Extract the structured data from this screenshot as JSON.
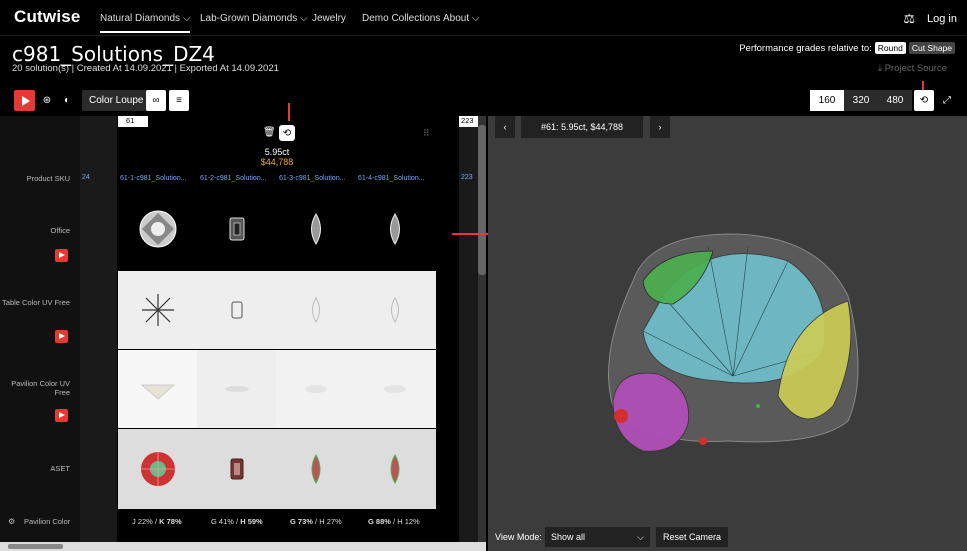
{
  "nav": {
    "logo": "Cutwise",
    "items": [
      "Natural Diamonds",
      "Lab-Grown Diamonds",
      "Jewelry",
      "Demo Collections",
      "About"
    ],
    "login": "Log in"
  },
  "project": {
    "title": "c981_Solutions_DZ4",
    "meta": "20 solution(s) | Created At 14.09.2021 | Exported At 14.09.2021",
    "perf_label": "Performance grades relative to:",
    "perf_round": "Round",
    "perf_cut": "Cut Shape",
    "project_source": "Project Source"
  },
  "toolbar": {
    "color_loupe": "Color Loupe",
    "sizes": [
      "160",
      "320",
      "480"
    ]
  },
  "labels": {
    "sku": "Product SKU",
    "office": "Office",
    "table_uv": "Table Color UV Free",
    "pavilion_uv": "Pavilion Color UV Free",
    "aset": "ASET",
    "pavilion_color": "Pavilion Color"
  },
  "grid": {
    "left_col": "61",
    "right_col": "223",
    "left_sku": "24",
    "right_sku": "223",
    "weight": "5.95ct",
    "price": "$44,788",
    "skus": [
      "61-1-c981_Solution...",
      "61-2-c981_Solution...",
      "61-3-c981_Solution...",
      "61-4-c981_Solution..."
    ],
    "grades": [
      {
        "a": "J 22%",
        "b": "K 78%"
      },
      {
        "a": "G 41%",
        "b": "H 59%"
      },
      {
        "a": "G 73%",
        "b": "H 27%"
      },
      {
        "a": "G 88%",
        "b": "H 12%"
      }
    ]
  },
  "viewer": {
    "title": "#61: 5.95ct, $44,788",
    "view_mode_label": "View Mode:",
    "view_mode_value": "Show all",
    "reset": "Reset Camera"
  },
  "colors": {
    "accent": "#e53935",
    "sku_link": "#6fa8ff",
    "price": "#f5a623"
  }
}
